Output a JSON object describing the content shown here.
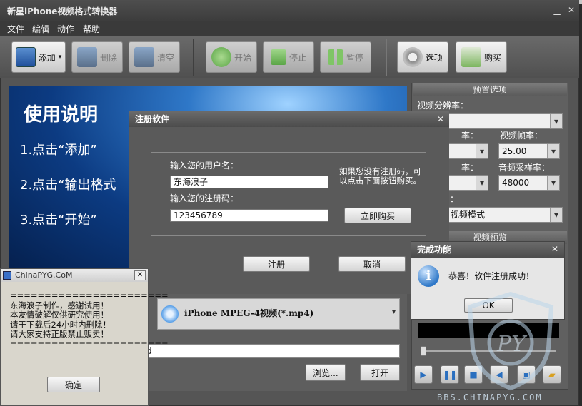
{
  "window": {
    "title": "新星iPhone视频格式转换器"
  },
  "menu": [
    "文件",
    "编辑",
    "动作",
    "帮助"
  ],
  "toolbar": {
    "add": "添加",
    "delete": "删除",
    "clear": "清空",
    "start": "开始",
    "stop": "停止",
    "pause": "暂停",
    "options": "选项",
    "buy": "购买"
  },
  "preview": {
    "title": "使用说明",
    "step1": "1.点击“添加”",
    "step2": "2.点击“输出格式",
    "step3": "3.点击“开始”"
  },
  "format": {
    "selected": "iPhone MPEG-4视频(*.mp4)"
  },
  "output": {
    "path": "d"
  },
  "buttons": {
    "browse": "浏览...",
    "open": "打开"
  },
  "presets": {
    "header": "预置选项",
    "resolution_label": "视频分辨率：",
    "resolution_value": "",
    "bitrate_label": "率：",
    "bitrate_value": "",
    "framerate_label": "视频帧率：",
    "framerate_value": "25.00",
    "audio_label": "率：",
    "audio_value": "",
    "samplerate_label": "音频采样率：",
    "samplerate_value": "48000",
    "mode_label": "：",
    "mode_value": "视频模式"
  },
  "video_preview": {
    "header": "视频预览"
  },
  "reg_dialog": {
    "title": "注册软件",
    "username_label": "输入您的用户名：",
    "username_value": "东海浪子",
    "code_label": "输入您的注册码：",
    "code_value": "123456789",
    "hint": "如果您没有注册码，可以点击下面按钮购买。",
    "buy_now": "立即购买",
    "register": "注册",
    "cancel": "取消"
  },
  "done_dialog": {
    "title": "完成功能",
    "message": "恭喜！软件注册成功！",
    "ok": "OK"
  },
  "pyg_dialog": {
    "title": "ChinaPYG.CoM",
    "body": "=======================\n东海浪子制作，感谢试用！\n本友情破解仅供研究使用！\n请于下载后24小时内删除！\n请大家支持正版禁止贩卖！\n=======================",
    "confirm": "确定"
  },
  "watermark": {
    "url": "BBS.CHINAPYG.COM",
    "logo_text": "PY"
  },
  "colors": {
    "accent_blue": "#2f78c8",
    "dark_gray": "#5a5a5a"
  }
}
